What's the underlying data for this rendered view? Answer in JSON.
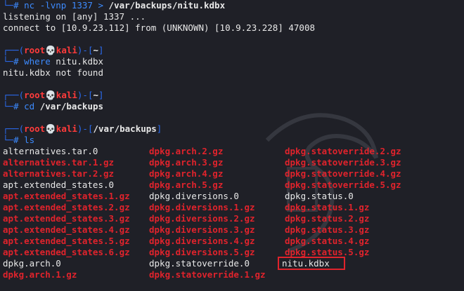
{
  "session": {
    "nc_cmd": "nc -lvnp 1337 > ",
    "nc_target": "/var/backups/nitu.kdbx",
    "listen": "listening on [any] 1337 ...",
    "connect": "connect to [10.9.23.112] from (UNKNOWN) [10.9.23.228] 47008"
  },
  "prompt": {
    "user": "root",
    "host": "kali"
  },
  "blocks": [
    {
      "cwd": "~",
      "cmd": "where",
      "arg": "nitu.kdbx",
      "output": "nitu.kdbx not found"
    },
    {
      "cwd": "~",
      "cmd": "cd",
      "arg": "/var/backups"
    },
    {
      "cwd": "/var/backups",
      "cmd": "ls",
      "arg": ""
    }
  ],
  "ls_rows": [
    [
      {
        "t": "alternatives.tar.0",
        "gz": false
      },
      {
        "t": "dpkg.arch.2.gz",
        "gz": true
      },
      {
        "t": "dpkg.statoverride.2.gz",
        "gz": true
      }
    ],
    [
      {
        "t": "alternatives.tar.1.gz",
        "gz": true
      },
      {
        "t": "dpkg.arch.3.gz",
        "gz": true
      },
      {
        "t": "dpkg.statoverride.3.gz",
        "gz": true
      }
    ],
    [
      {
        "t": "alternatives.tar.2.gz",
        "gz": true
      },
      {
        "t": "dpkg.arch.4.gz",
        "gz": true
      },
      {
        "t": "dpkg.statoverride.4.gz",
        "gz": true
      }
    ],
    [
      {
        "t": "apt.extended_states.0",
        "gz": false
      },
      {
        "t": "dpkg.arch.5.gz",
        "gz": true
      },
      {
        "t": "dpkg.statoverride.5.gz",
        "gz": true
      }
    ],
    [
      {
        "t": "apt.extended_states.1.gz",
        "gz": true
      },
      {
        "t": "dpkg.diversions.0",
        "gz": false
      },
      {
        "t": "dpkg.status.0",
        "gz": false
      }
    ],
    [
      {
        "t": "apt.extended_states.2.gz",
        "gz": true
      },
      {
        "t": "dpkg.diversions.1.gz",
        "gz": true
      },
      {
        "t": "dpkg.status.1.gz",
        "gz": true
      }
    ],
    [
      {
        "t": "apt.extended_states.3.gz",
        "gz": true
      },
      {
        "t": "dpkg.diversions.2.gz",
        "gz": true
      },
      {
        "t": "dpkg.status.2.gz",
        "gz": true
      }
    ],
    [
      {
        "t": "apt.extended_states.4.gz",
        "gz": true
      },
      {
        "t": "dpkg.diversions.3.gz",
        "gz": true
      },
      {
        "t": "dpkg.status.3.gz",
        "gz": true
      }
    ],
    [
      {
        "t": "apt.extended_states.5.gz",
        "gz": true
      },
      {
        "t": "dpkg.diversions.4.gz",
        "gz": true
      },
      {
        "t": "dpkg.status.4.gz",
        "gz": true
      }
    ],
    [
      {
        "t": "apt.extended_states.6.gz",
        "gz": true
      },
      {
        "t": "dpkg.diversions.5.gz",
        "gz": true
      },
      {
        "t": "dpkg.status.5.gz",
        "gz": true
      }
    ],
    [
      {
        "t": "dpkg.arch.0",
        "gz": false
      },
      {
        "t": "dpkg.statoverride.0",
        "gz": false
      },
      {
        "t": "nitu.kdbx",
        "gz": false,
        "highlight": true
      }
    ],
    [
      {
        "t": "dpkg.arch.1.gz",
        "gz": true
      },
      {
        "t": "dpkg.statoverride.1.gz",
        "gz": true
      },
      {
        "t": "",
        "gz": false
      }
    ]
  ],
  "colors": {
    "background": "#1f2027",
    "frame": "#2b6cf1",
    "user": "#ff3b3b",
    "archive": "#e0232c"
  },
  "icons": {
    "prompt_separator": "skull-icon"
  }
}
